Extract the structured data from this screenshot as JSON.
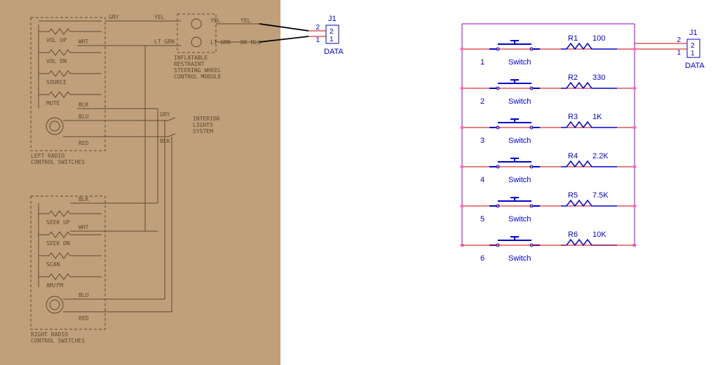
{
  "left": {
    "switches_top": {
      "items": [
        "VOL UP",
        "VOL DN",
        "SOURCE",
        "MUTE"
      ],
      "title": "LEFT RADIO\nCONTROL SWITCHES",
      "wires": [
        "GRY",
        "YEL",
        "WHT",
        "BLK",
        "BLU",
        "RED"
      ]
    },
    "switches_bot": {
      "items": [
        "SEEK UP",
        "SEEK DN",
        "SCAN",
        "AM/FM"
      ],
      "title": "RIGHT RADIO\nCONTROL SWITCHES",
      "wires": [
        "BLK",
        "WHT",
        "BLU",
        "RED"
      ]
    },
    "module": {
      "title": "INFLATABLE\nRESTRAINT\nSTEERING WHEEL\nCONTROL MODULE",
      "top_in": "YEL",
      "top_out": "YEL",
      "bot_in": "LT GRN",
      "bot_out": "LT GRN",
      "top_far": "YEL",
      "bot_far": "DK BLU"
    },
    "interior": {
      "top": "GRY",
      "bot": "BLK",
      "label": "INTERIOR\nLIGHTS\nSYSTEM"
    },
    "conn": {
      "name": "J1",
      "pin1": "1",
      "pin2": "2",
      "label": "DATA"
    }
  },
  "right": {
    "rows": [
      {
        "idx": "1",
        "sw": "Switch",
        "r": "R1",
        "v": "100"
      },
      {
        "idx": "2",
        "sw": "Switch",
        "r": "R2",
        "v": "330"
      },
      {
        "idx": "3",
        "sw": "Switch",
        "r": "R3",
        "v": "1K"
      },
      {
        "idx": "4",
        "sw": "Switch",
        "r": "R4",
        "v": "2.2K"
      },
      {
        "idx": "5",
        "sw": "Switch",
        "r": "R5",
        "v": "7.5K"
      },
      {
        "idx": "6",
        "sw": "Switch",
        "r": "R6",
        "v": "10K"
      }
    ],
    "conn": {
      "name": "J1",
      "pin1": "1",
      "pin2": "2",
      "label": "DATA"
    }
  }
}
